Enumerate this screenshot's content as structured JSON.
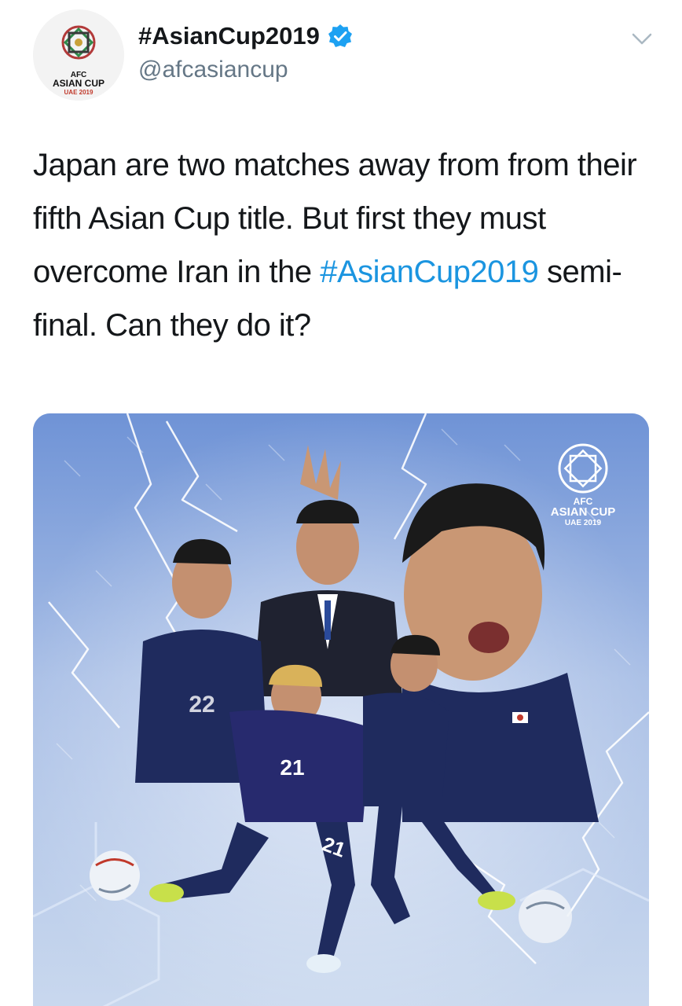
{
  "account": {
    "display_name": "#AsianCup2019",
    "handle": "@afcasiancup",
    "avatar_logo": {
      "line1": "AFC",
      "line2": "ASIAN CUP",
      "line3": "UAE 2019"
    }
  },
  "tweet": {
    "text_before_hashtag": "Japan are two matches away from from their fifth Asian Cup title. But first they must overcome Iran in the ",
    "hashtag": "#AsianCup2019",
    "text_after_hashtag": " semi-final. Can they do it?"
  },
  "media": {
    "logo": {
      "line1": "AFC",
      "line2": "ASIAN CUP",
      "line3": "UAE 2019"
    },
    "jersey_numbers": [
      "22",
      "21",
      "21"
    ]
  },
  "colors": {
    "hashtag": "#1b95e0",
    "verified": "#1da1f2",
    "secondary_text": "#657786",
    "primary_text": "#14171a"
  },
  "icons": [
    "verified-badge-icon",
    "chevron-down-icon"
  ]
}
